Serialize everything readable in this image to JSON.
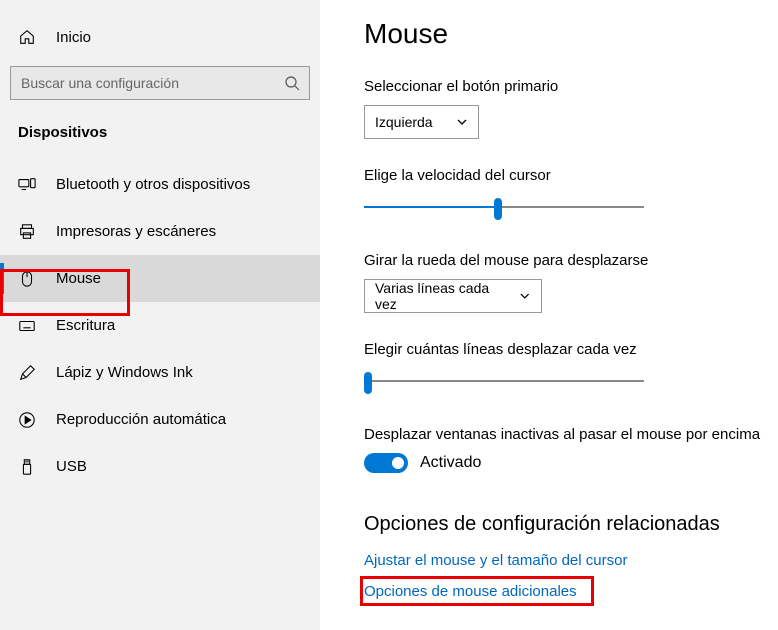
{
  "sidebar": {
    "home": "Inicio",
    "search_placeholder": "Buscar una configuración",
    "category": "Dispositivos",
    "items": [
      {
        "label": "Bluetooth y otros dispositivos"
      },
      {
        "label": "Impresoras y escáneres"
      },
      {
        "label": "Mouse"
      },
      {
        "label": "Escritura"
      },
      {
        "label": "Lápiz y Windows Ink"
      },
      {
        "label": "Reproducción automática"
      },
      {
        "label": "USB"
      }
    ]
  },
  "main": {
    "title": "Mouse",
    "primary_button_label": "Seleccionar el botón primario",
    "primary_button_value": "Izquierda",
    "cursor_speed_label": "Elige la velocidad del cursor",
    "wheel_label": "Girar la rueda del mouse para desplazarse",
    "wheel_value": "Varias líneas cada vez",
    "lines_label": "Elegir cuántas líneas desplazar cada vez",
    "inactive_label": "Desplazar ventanas inactivas al pasar el mouse por encima",
    "toggle_state": "Activado",
    "related_title": "Opciones de configuración relacionadas",
    "link1": "Ajustar el mouse y el tamaño del cursor",
    "link2": "Opciones de mouse adicionales"
  }
}
